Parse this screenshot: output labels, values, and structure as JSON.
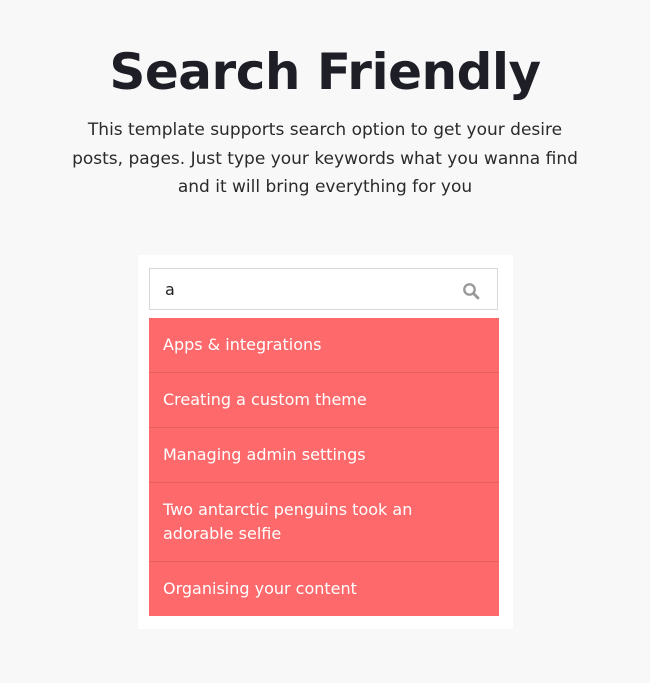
{
  "hero": {
    "title": "Search Friendly",
    "description": "This template supports search option to get your desire posts, pages. Just type your keywords what you wanna find and it will bring everything for you"
  },
  "search": {
    "value": "a",
    "placeholder": "",
    "icon": "search-icon"
  },
  "results": [
    "Apps & integrations",
    "Creating a custom theme",
    "Managing admin settings",
    "Two antarctic penguins took an adorable selfie",
    "Organising your content"
  ],
  "colors": {
    "background": "#f8f8f8",
    "result_bg": "#fe6a6c",
    "result_text": "#ffffff",
    "title": "#1e1e26"
  }
}
